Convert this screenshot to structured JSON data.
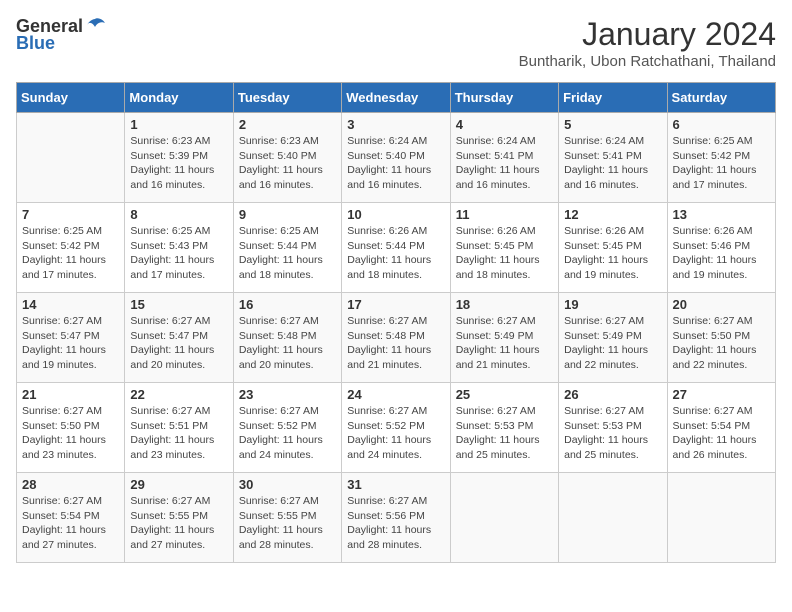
{
  "header": {
    "logo_general": "General",
    "logo_blue": "Blue",
    "month_title": "January 2024",
    "location": "Buntharik, Ubon Ratchathani, Thailand"
  },
  "days": [
    "Sunday",
    "Monday",
    "Tuesday",
    "Wednesday",
    "Thursday",
    "Friday",
    "Saturday"
  ],
  "weeks": [
    [
      {
        "date": "",
        "sunrise": "",
        "sunset": "",
        "daylight": ""
      },
      {
        "date": "1",
        "sunrise": "Sunrise: 6:23 AM",
        "sunset": "Sunset: 5:39 PM",
        "daylight": "Daylight: 11 hours and 16 minutes."
      },
      {
        "date": "2",
        "sunrise": "Sunrise: 6:23 AM",
        "sunset": "Sunset: 5:40 PM",
        "daylight": "Daylight: 11 hours and 16 minutes."
      },
      {
        "date": "3",
        "sunrise": "Sunrise: 6:24 AM",
        "sunset": "Sunset: 5:40 PM",
        "daylight": "Daylight: 11 hours and 16 minutes."
      },
      {
        "date": "4",
        "sunrise": "Sunrise: 6:24 AM",
        "sunset": "Sunset: 5:41 PM",
        "daylight": "Daylight: 11 hours and 16 minutes."
      },
      {
        "date": "5",
        "sunrise": "Sunrise: 6:24 AM",
        "sunset": "Sunset: 5:41 PM",
        "daylight": "Daylight: 11 hours and 16 minutes."
      },
      {
        "date": "6",
        "sunrise": "Sunrise: 6:25 AM",
        "sunset": "Sunset: 5:42 PM",
        "daylight": "Daylight: 11 hours and 17 minutes."
      }
    ],
    [
      {
        "date": "7",
        "sunrise": "Sunrise: 6:25 AM",
        "sunset": "Sunset: 5:42 PM",
        "daylight": "Daylight: 11 hours and 17 minutes."
      },
      {
        "date": "8",
        "sunrise": "Sunrise: 6:25 AM",
        "sunset": "Sunset: 5:43 PM",
        "daylight": "Daylight: 11 hours and 17 minutes."
      },
      {
        "date": "9",
        "sunrise": "Sunrise: 6:25 AM",
        "sunset": "Sunset: 5:44 PM",
        "daylight": "Daylight: 11 hours and 18 minutes."
      },
      {
        "date": "10",
        "sunrise": "Sunrise: 6:26 AM",
        "sunset": "Sunset: 5:44 PM",
        "daylight": "Daylight: 11 hours and 18 minutes."
      },
      {
        "date": "11",
        "sunrise": "Sunrise: 6:26 AM",
        "sunset": "Sunset: 5:45 PM",
        "daylight": "Daylight: 11 hours and 18 minutes."
      },
      {
        "date": "12",
        "sunrise": "Sunrise: 6:26 AM",
        "sunset": "Sunset: 5:45 PM",
        "daylight": "Daylight: 11 hours and 19 minutes."
      },
      {
        "date": "13",
        "sunrise": "Sunrise: 6:26 AM",
        "sunset": "Sunset: 5:46 PM",
        "daylight": "Daylight: 11 hours and 19 minutes."
      }
    ],
    [
      {
        "date": "14",
        "sunrise": "Sunrise: 6:27 AM",
        "sunset": "Sunset: 5:47 PM",
        "daylight": "Daylight: 11 hours and 19 minutes."
      },
      {
        "date": "15",
        "sunrise": "Sunrise: 6:27 AM",
        "sunset": "Sunset: 5:47 PM",
        "daylight": "Daylight: 11 hours and 20 minutes."
      },
      {
        "date": "16",
        "sunrise": "Sunrise: 6:27 AM",
        "sunset": "Sunset: 5:48 PM",
        "daylight": "Daylight: 11 hours and 20 minutes."
      },
      {
        "date": "17",
        "sunrise": "Sunrise: 6:27 AM",
        "sunset": "Sunset: 5:48 PM",
        "daylight": "Daylight: 11 hours and 21 minutes."
      },
      {
        "date": "18",
        "sunrise": "Sunrise: 6:27 AM",
        "sunset": "Sunset: 5:49 PM",
        "daylight": "Daylight: 11 hours and 21 minutes."
      },
      {
        "date": "19",
        "sunrise": "Sunrise: 6:27 AM",
        "sunset": "Sunset: 5:49 PM",
        "daylight": "Daylight: 11 hours and 22 minutes."
      },
      {
        "date": "20",
        "sunrise": "Sunrise: 6:27 AM",
        "sunset": "Sunset: 5:50 PM",
        "daylight": "Daylight: 11 hours and 22 minutes."
      }
    ],
    [
      {
        "date": "21",
        "sunrise": "Sunrise: 6:27 AM",
        "sunset": "Sunset: 5:50 PM",
        "daylight": "Daylight: 11 hours and 23 minutes."
      },
      {
        "date": "22",
        "sunrise": "Sunrise: 6:27 AM",
        "sunset": "Sunset: 5:51 PM",
        "daylight": "Daylight: 11 hours and 23 minutes."
      },
      {
        "date": "23",
        "sunrise": "Sunrise: 6:27 AM",
        "sunset": "Sunset: 5:52 PM",
        "daylight": "Daylight: 11 hours and 24 minutes."
      },
      {
        "date": "24",
        "sunrise": "Sunrise: 6:27 AM",
        "sunset": "Sunset: 5:52 PM",
        "daylight": "Daylight: 11 hours and 24 minutes."
      },
      {
        "date": "25",
        "sunrise": "Sunrise: 6:27 AM",
        "sunset": "Sunset: 5:53 PM",
        "daylight": "Daylight: 11 hours and 25 minutes."
      },
      {
        "date": "26",
        "sunrise": "Sunrise: 6:27 AM",
        "sunset": "Sunset: 5:53 PM",
        "daylight": "Daylight: 11 hours and 25 minutes."
      },
      {
        "date": "27",
        "sunrise": "Sunrise: 6:27 AM",
        "sunset": "Sunset: 5:54 PM",
        "daylight": "Daylight: 11 hours and 26 minutes."
      }
    ],
    [
      {
        "date": "28",
        "sunrise": "Sunrise: 6:27 AM",
        "sunset": "Sunset: 5:54 PM",
        "daylight": "Daylight: 11 hours and 27 minutes."
      },
      {
        "date": "29",
        "sunrise": "Sunrise: 6:27 AM",
        "sunset": "Sunset: 5:55 PM",
        "daylight": "Daylight: 11 hours and 27 minutes."
      },
      {
        "date": "30",
        "sunrise": "Sunrise: 6:27 AM",
        "sunset": "Sunset: 5:55 PM",
        "daylight": "Daylight: 11 hours and 28 minutes."
      },
      {
        "date": "31",
        "sunrise": "Sunrise: 6:27 AM",
        "sunset": "Sunset: 5:56 PM",
        "daylight": "Daylight: 11 hours and 28 minutes."
      },
      {
        "date": "",
        "sunrise": "",
        "sunset": "",
        "daylight": ""
      },
      {
        "date": "",
        "sunrise": "",
        "sunset": "",
        "daylight": ""
      },
      {
        "date": "",
        "sunrise": "",
        "sunset": "",
        "daylight": ""
      }
    ]
  ]
}
